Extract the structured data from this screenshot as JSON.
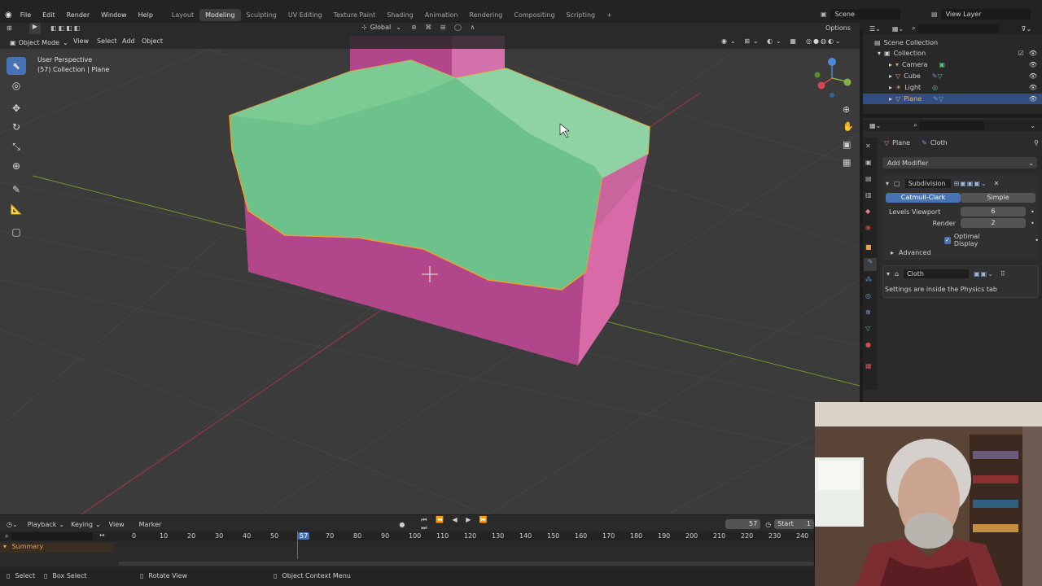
{
  "menu": {
    "items": [
      "File",
      "Edit",
      "Render",
      "Window",
      "Help"
    ],
    "workspaces": [
      "Layout",
      "Modeling",
      "Sculpting",
      "UV Editing",
      "Texture Paint",
      "Shading",
      "Animation",
      "Rendering",
      "Compositing",
      "Scripting"
    ],
    "active_workspace": "Modeling",
    "add_tab": "+",
    "scene": "Scene",
    "view_layer": "View Layer"
  },
  "viewport_header": {
    "mode": "Object Mode",
    "view": "View",
    "select": "Select",
    "add": "Add",
    "object": "Object",
    "orientation": "Global",
    "options": "Options"
  },
  "viewport": {
    "perspective": "User Perspective",
    "collection_info": "(57) Collection | Plane"
  },
  "outliner": {
    "scene_collection": "Scene Collection",
    "collection": "Collection",
    "items": [
      {
        "name": "Camera"
      },
      {
        "name": "Cube"
      },
      {
        "name": "Light"
      },
      {
        "name": "Plane",
        "selected": true
      }
    ]
  },
  "properties": {
    "object_name": "Plane",
    "modifier_name": "Cloth",
    "add_modifier": "Add Modifier",
    "subdivision": {
      "name": "Subdivision",
      "catmull_clark": "Catmull-Clark",
      "simple": "Simple",
      "levels_viewport_label": "Levels Viewport",
      "levels_viewport": "6",
      "render_label": "Render",
      "render": "2",
      "optimal_display": "Optimal Display",
      "advanced": "Advanced"
    },
    "cloth": {
      "name": "Cloth",
      "note": "Settings are inside the Physics tab"
    }
  },
  "timeline": {
    "playback": "Playback",
    "keying": "Keying",
    "view": "View",
    "marker": "Marker",
    "current_frame": "57",
    "start_label": "Start",
    "start": "1",
    "ticks": [
      "0",
      "10",
      "20",
      "30",
      "40",
      "50",
      "57",
      "70",
      "80",
      "90",
      "100",
      "110",
      "120",
      "130",
      "140",
      "150",
      "160",
      "170",
      "180",
      "190",
      "200",
      "210",
      "220",
      "230",
      "240"
    ],
    "summary": "Summary"
  },
  "statusbar": {
    "select": "Select",
    "box_select": "Box Select",
    "rotate_view": "Rotate View",
    "context_menu": "Object Context Menu"
  },
  "colors": {
    "accent": "#4772b3",
    "cloth": "#78c98e",
    "cube": "#c44f96",
    "selection": "#f0a030"
  }
}
